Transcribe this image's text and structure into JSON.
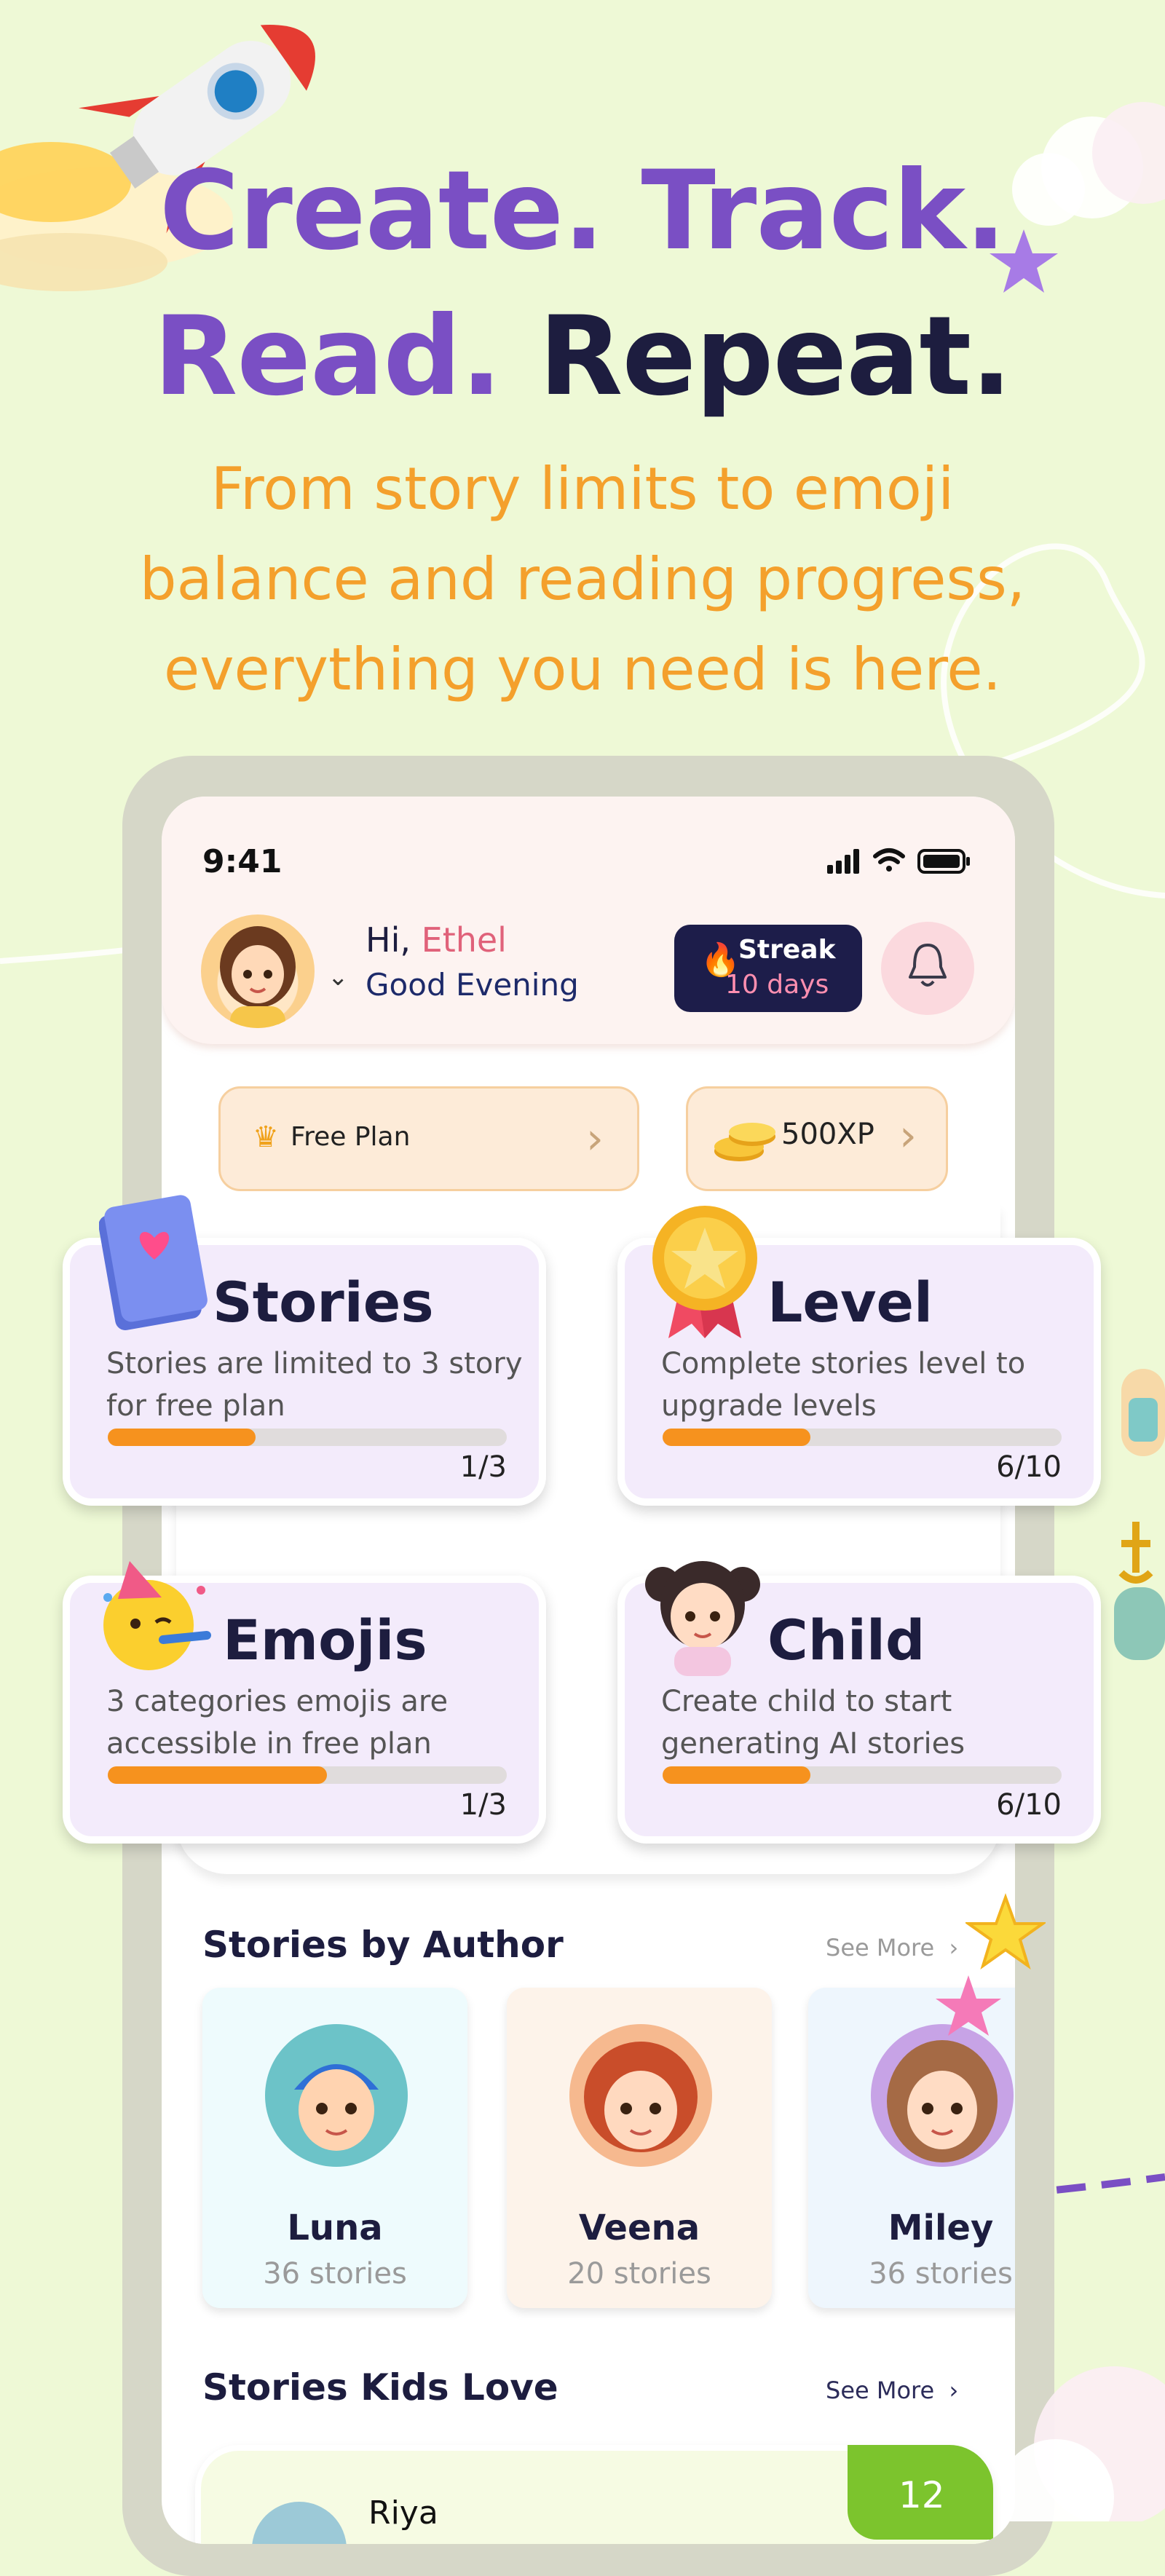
{
  "hero": {
    "line1": "Create. Track.",
    "line2_purple": "Read.",
    "line2_dark": "Repeat.",
    "subtitle_lines": [
      "From story limits to emoji",
      "balance and reading progress,",
      "everything you need is here."
    ]
  },
  "status_bar": {
    "time": "9:41"
  },
  "greeting": {
    "hi": "Hi,",
    "name": "Ethel",
    "sub": "Good Evening"
  },
  "streak": {
    "label": "Streak",
    "days": "10 days"
  },
  "plan": {
    "label": "Free Plan"
  },
  "xp": {
    "label": "500XP"
  },
  "cards": [
    {
      "title": "Stories",
      "desc": "Stories are limited to 3 story for free plan",
      "count": "1/3",
      "progress": 0.37,
      "icon": "book-heart-icon"
    },
    {
      "title": "Level",
      "desc": "Complete stories level to upgrade levels",
      "count": "6/10",
      "progress": 0.37,
      "icon": "star-medal-icon"
    },
    {
      "title": "Emojis",
      "desc": "3 categories emojis are accessible in free plan",
      "count": "1/3",
      "progress": 0.55,
      "icon": "party-emoji-icon"
    },
    {
      "title": "Child",
      "desc": "Create child to start generating AI stories",
      "count": "6/10",
      "progress": 0.37,
      "icon": "girl-avatar-icon"
    }
  ],
  "authors_section": {
    "title": "Stories by Author",
    "see_more": "See More",
    "authors": [
      {
        "name": "Luna",
        "count": "36 stories",
        "bg": "#eefbfd"
      },
      {
        "name": "Veena",
        "count": "20 stories",
        "bg": "#fdf3ea"
      },
      {
        "name": "Miley",
        "count": "36 stories",
        "bg": "#eef6fd"
      }
    ]
  },
  "kids_section": {
    "title": "Stories Kids Love",
    "see_more": "See More",
    "first_item": {
      "name": "Riya",
      "number": "12"
    }
  },
  "colors": {
    "background": "#eef9d6",
    "purple": "#7a4fc4",
    "navy": "#1d1d3f",
    "orange": "#f4a02c",
    "progress": "#f6921e",
    "card_bg": "#f3ebfb"
  }
}
